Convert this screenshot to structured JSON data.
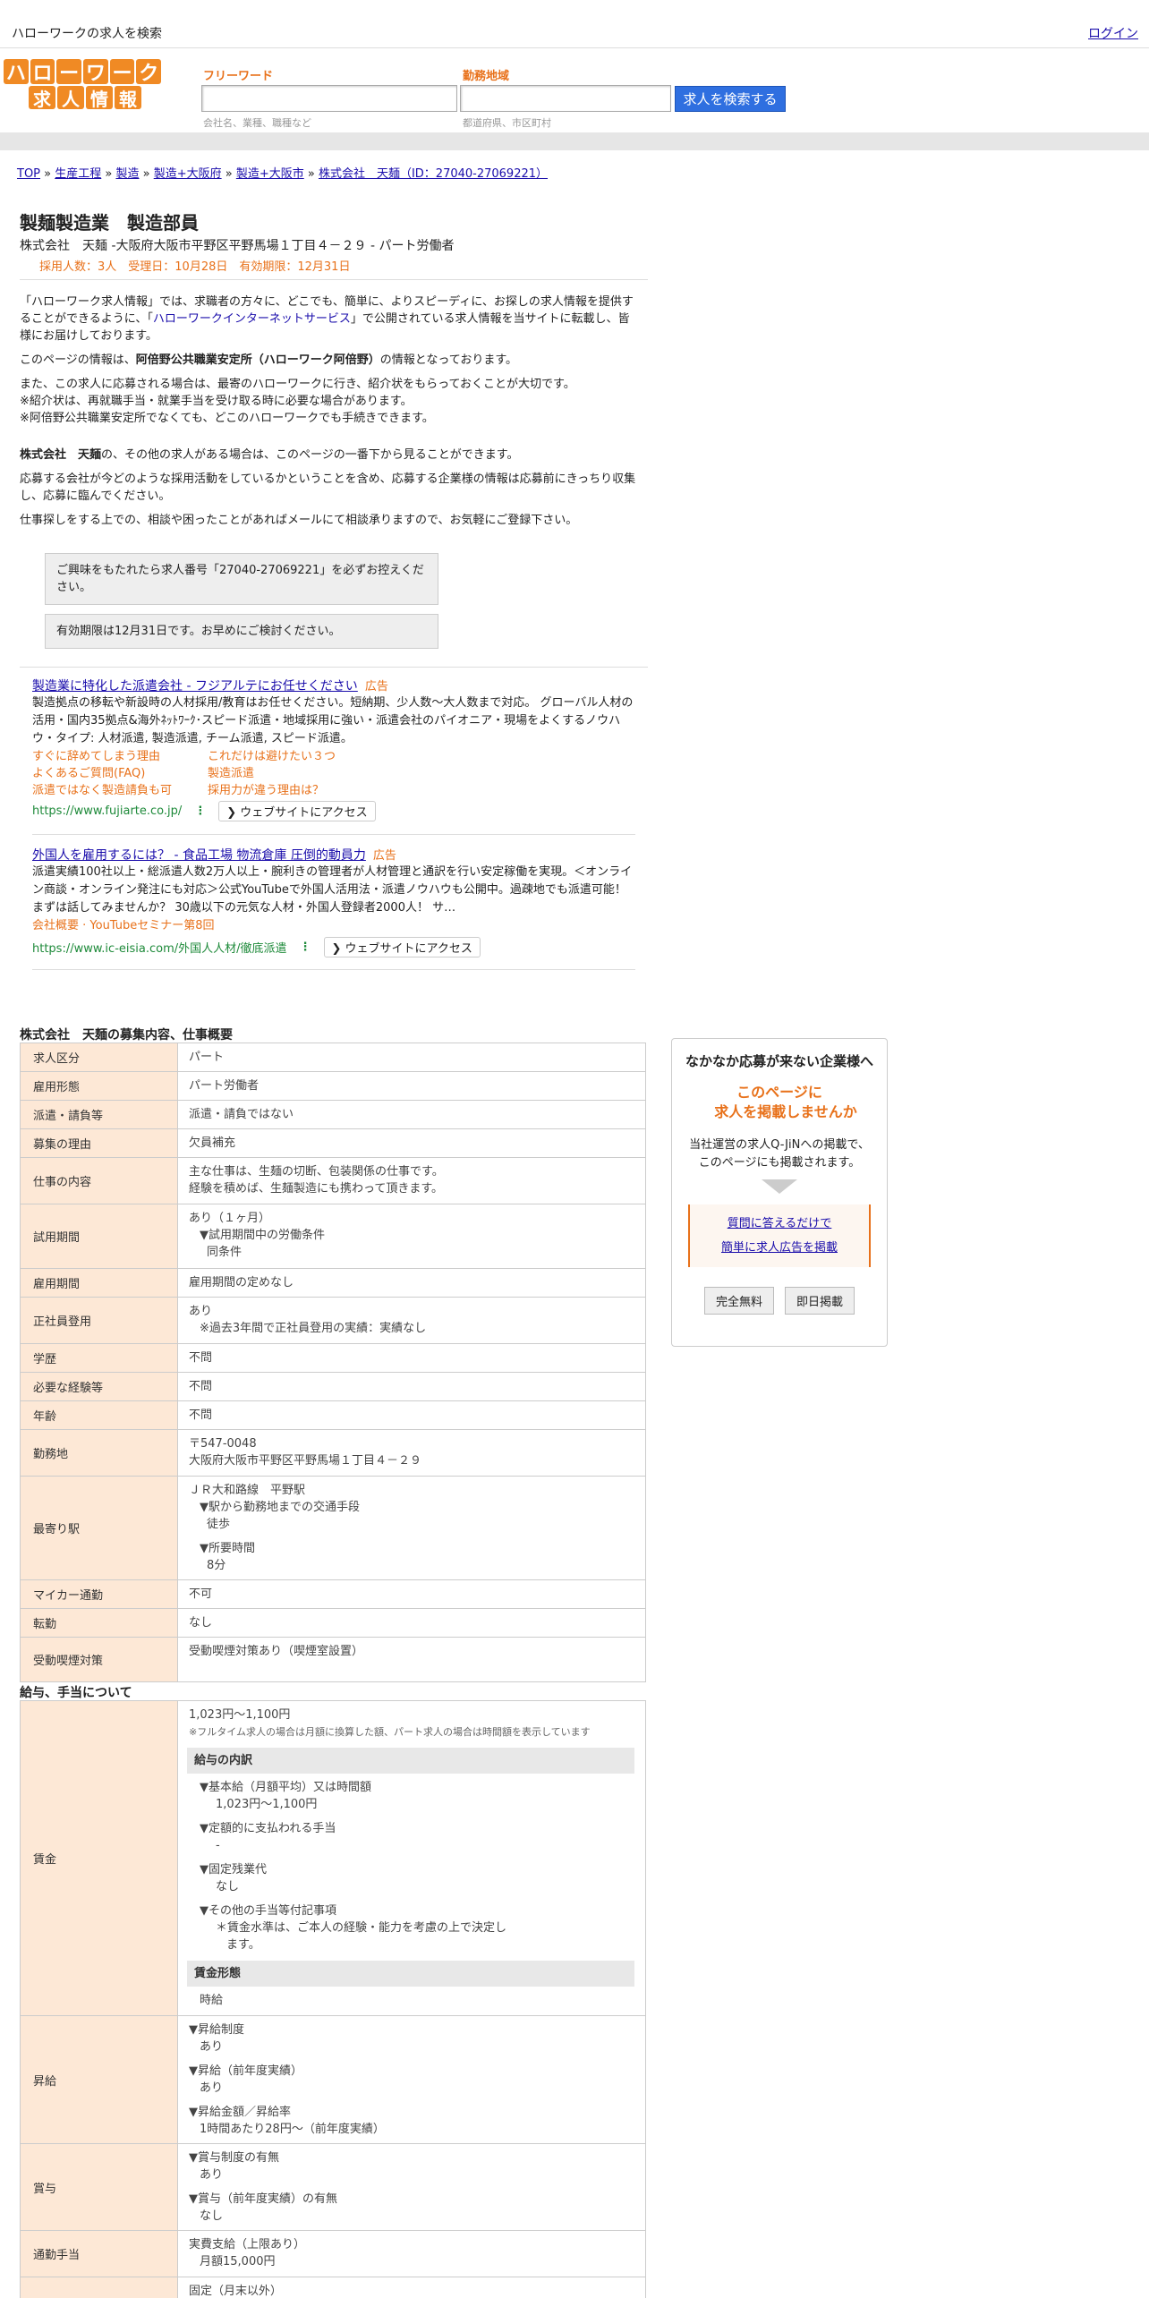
{
  "topbar": {
    "title": "ハローワークの求人を検索",
    "login": "ログイン"
  },
  "logo": {
    "row1": [
      "ハ",
      "ロ",
      "ー",
      "ワ",
      "ー",
      "ク"
    ],
    "row2": [
      "求",
      "人",
      "情",
      "報"
    ]
  },
  "search": {
    "freeword_label": "フリーワード",
    "freeword_placeholder": "会社名、業種、職種など",
    "area_label": "勤務地域",
    "area_placeholder": "都道府県、市区町村",
    "button": "求人を検索する"
  },
  "breadcrumb": [
    "TOP",
    "生産工程",
    "製造",
    "製造+大阪府",
    "製造+大阪市",
    "株式会社　天麺（ID：27040-27069221）"
  ],
  "job": {
    "title": "製麺製造業　製造部員",
    "subtitle": "株式会社　天麺 -大阪府大阪市平野区平野馬場１丁目４－２９ - パート労働者",
    "meta": "採用人数：3人　受理日：10月28日　有効期限：12月31日"
  },
  "intro": {
    "p1_a": "「ハローワーク求人情報」では、求職者の方々に、どこでも、簡単に、よりスピーディに、お探しの求人情報を提供することができるように、「",
    "p1_link": "ハローワークインターネットサービス",
    "p1_b": "」で公開されている求人情報を当サイトに転載し、皆様にお届けしております。",
    "p2_a": "このページの情報は、",
    "p2_bold": "阿倍野公共職業安定所（ハローワーク阿倍野）",
    "p2_b": "の情報となっております。",
    "p3_1": "また、この求人に応募される場合は、最寄のハローワークに行き、紹介状をもらっておくことが大切です。",
    "p3_2": "※紹介状は、再就職手当・就業手当を受け取る時に必要な場合があります。",
    "p3_3": "※阿倍野公共職業安定所でなくても、どこのハローワークでも手続きできます。",
    "p4_bold": "株式会社　天麺",
    "p4_b": "の、その他の求人がある場合は、このページの一番下から見ることができます。",
    "p5": "応募する会社が今どのような採用活動をしているかということを含め、応募する企業様の情報は応募前にきっちり収集し、応募に臨んでください。",
    "p6": "仕事探しをする上での、相談や困ったことがあればメールにて相談承りますので、お気軽にご登録下さい。"
  },
  "notices": {
    "n1": "ご興味をもたれたら求人番号「27040-27069221」を必ずお控えください。",
    "n2": "有効期限は12月31日です。お早めにご検討ください。"
  },
  "ads": [
    {
      "title": "製造業に特化した派遣会社 - フジアルテにお任せください",
      "tag": "広告",
      "desc": "製造拠点の移転や新設時の人材採用/教育はお任せください。短納期、少人数〜大人数まで対応。 グローバル人材の活用・国内35拠点&海外ﾈｯﾄﾜｰｸ･スピード派遣・地域採用に強い・派遣会社のパイオニア・現場をよくするノウハウ・タイプ: 人材派遣, 製造派遣, チーム派遣, スピード派遣。",
      "links": [
        "すぐに辞めてしまう理由",
        "これだけは避けたい３つ",
        "よくあるご質問(FAQ)",
        "製造派遣",
        "派遣ではなく製造請負も可",
        "採用力が違う理由は？"
      ],
      "url": "https://www.fujiarte.co.jp/",
      "visit": "ウェブサイトにアクセス"
    },
    {
      "title": "外国人を雇用するには？ - 食品工場 物流倉庫 圧倒的動員力",
      "tag": "広告",
      "desc": "派遣実績100社以上・総派遣人数2万人以上・腕利きの管理者が人材管理と通訳を行い安定稼働を実現。＜オンライン商談・オンライン発注にも対応＞公式YouTubeで外国人活用法・派遣ノウハウも公開中。過疎地でも派遣可能！ まずは話してみませんか？ 30歳以下の元気な人材・外国人登録者2000人！ サ…",
      "links": [
        "会社概要 · YouTubeセミナー第8回"
      ],
      "url": "https://www.ic-eisia.com/外国人人材/徹底派遣",
      "visit": "ウェブサイトにアクセス"
    }
  ],
  "recruit": {
    "title": "株式会社　天麺の募集内容、仕事概要",
    "rows": {
      "r1_k": "求人区分",
      "r1_v": "パート",
      "r2_k": "雇用形態",
      "r2_v": "パート労働者",
      "r3_k": "派遣・請負等",
      "r3_v": "派遣・請負ではない",
      "r4_k": "募集の理由",
      "r4_v": "欠員補充",
      "r5_k": "仕事の内容",
      "r5_v1": "主な仕事は、生麺の切断、包装関係の仕事です。",
      "r5_v2": "経験を積めば、生麺製造にも携わって頂きます。",
      "r6_k": "試用期間",
      "r6_v1": "あり（１ヶ月）",
      "r6_v2": "▼試用期間中の労働条件",
      "r6_v3": "同条件",
      "r7_k": "雇用期間",
      "r7_v": "雇用期間の定めなし",
      "r8_k": "正社員登用",
      "r8_v1": "あり",
      "r8_v2": "※過去3年間で正社員登用の実績：実績なし",
      "r9_k": "学歴",
      "r9_v": "不問",
      "r10_k": "必要な経験等",
      "r10_v": "不問",
      "r11_k": "年齢",
      "r11_v": "不問",
      "r12_k": "勤務地",
      "r12_v1": "〒547-0048",
      "r12_v2": "大阪府大阪市平野区平野馬場１丁目４－２９",
      "r13_k": "最寄り駅",
      "r13_v1": "ＪＲ大和路線　平野駅",
      "r13_v2": "▼駅から勤務地までの交通手段",
      "r13_v3": "徒歩",
      "r13_v4": "▼所要時間",
      "r13_v5": "8分",
      "r14_k": "マイカー通勤",
      "r14_v": "不可",
      "r15_k": "転勤",
      "r15_v": "なし",
      "r16_k": "受動喫煙対策",
      "r16_v": "受動喫煙対策あり（喫煙室設置）"
    }
  },
  "salary": {
    "title": "給与、手当について",
    "wage_k": "賃金",
    "wage_v": "1,023円〜1,100円",
    "wage_note": "※フルタイム求人の場合は月額に換算した額、パート求人の場合は時間額を表示しています",
    "breakdown_h": "給与の内訳",
    "b1": "▼基本給（月額平均）又は時間額",
    "b1v": "1,023円〜1,100円",
    "b2": "▼定額的に支払われる手当",
    "b2v": "-",
    "b3": "▼固定残業代",
    "b3v": "なし",
    "b4": "▼その他の手当等付記事項",
    "b4v": "＊賃金水準は、ご本人の経験・能力を考慮の上で決定し",
    "b4v2": "ます。",
    "form_h": "賃金形態",
    "form_v": "時給",
    "raise_k": "昇給",
    "raise1": "▼昇給制度",
    "raise1v": "あり",
    "raise2": "▼昇給（前年度実績）",
    "raise2v": "あり",
    "raise3": "▼昇給金額／昇給率",
    "raise3v": "1時間あたり28円〜（前年度実績）",
    "bonus_k": "賞与",
    "bonus1": "▼賞与制度の有無",
    "bonus1v": "あり",
    "bonus2": "▼賞与（前年度実績）の有無",
    "bonus2v": "なし",
    "commute_k": "通勤手当",
    "commute_v1": "実費支給（上限あり）",
    "commute_v2": "月額15,000円",
    "next_v": "固定（月末以外）"
  },
  "side": {
    "heading": "なかなか応募が来ない企業様へ",
    "highlight1": "このページに",
    "highlight2": "求人を掲載しませんか",
    "desc1": "当社運営の求人Q-JiNへの掲載で、",
    "desc2": "このページにも掲載されます。",
    "link1": "質問に答えるだけで",
    "link2": "簡単に求人広告を掲載",
    "btn1": "完全無料",
    "btn2": "即日掲載"
  }
}
